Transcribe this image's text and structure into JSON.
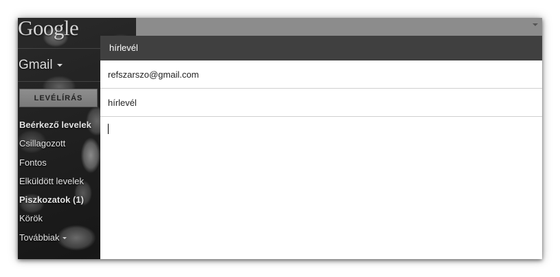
{
  "sidebar": {
    "logo": "Google",
    "app_switcher": "Gmail",
    "compose_label": "LEVÉLÍRÁS",
    "items": [
      {
        "label": "Beérkező levelek",
        "bold": true
      },
      {
        "label": "Csillagozott",
        "bold": false
      },
      {
        "label": "Fontos",
        "bold": false
      },
      {
        "label": "Elküldött levelek",
        "bold": false
      },
      {
        "label": "Piszkozatok (1)",
        "bold": true
      },
      {
        "label": "Körök",
        "bold": false
      },
      {
        "label": "Továbbiak",
        "bold": false
      }
    ]
  },
  "compose": {
    "title": "hírlevél",
    "to_value": "refszarszo@gmail.com",
    "subject_value": "hírlevél",
    "body_value": ""
  },
  "colors": {
    "header_bg": "#404040",
    "compose_btn": "#8a8a8a"
  }
}
